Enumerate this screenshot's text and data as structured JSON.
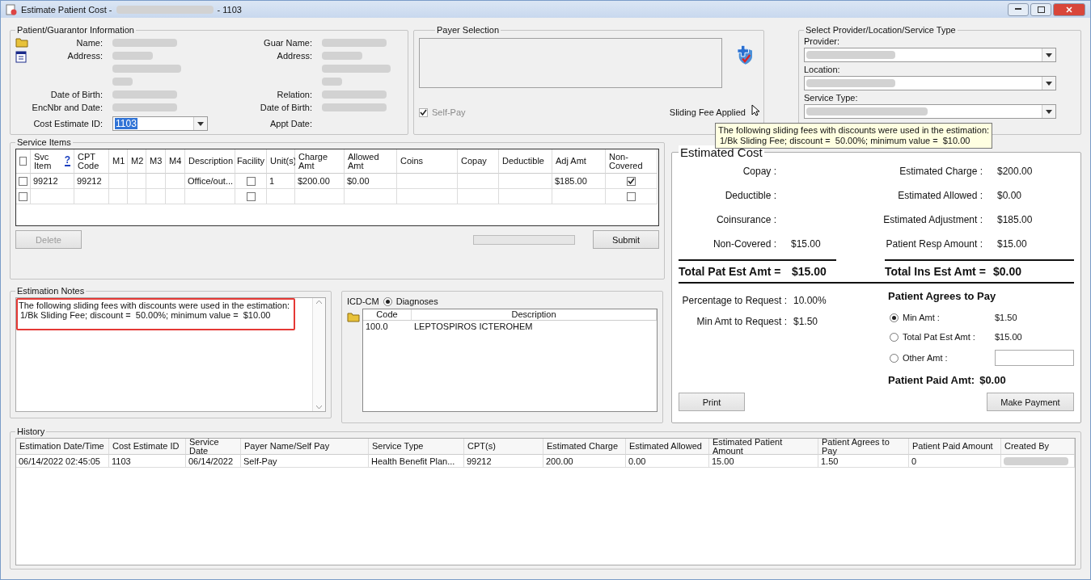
{
  "window": {
    "title": "Estimate Patient Cost -",
    "title_suffix": "- 1103"
  },
  "patient": {
    "title": "Patient/Guarantor Information",
    "left": [
      {
        "label": "Name:",
        "kind": "redacted"
      },
      {
        "label": "Address:",
        "kind": "address"
      },
      {
        "label": "Date of Birth:",
        "kind": "redacted"
      },
      {
        "label": "EncNbr and Date:",
        "kind": "redacted"
      },
      {
        "label": "Cost Estimate ID:",
        "kind": "combo",
        "value": "1103"
      }
    ],
    "right": [
      {
        "label": "Guar Name:",
        "kind": "redacted"
      },
      {
        "label": "Address:",
        "kind": "address"
      },
      {
        "label": "Relation:",
        "kind": "redacted"
      },
      {
        "label": "Date of Birth:",
        "kind": "redacted"
      },
      {
        "label": "Appt Date:",
        "kind": "blank"
      }
    ]
  },
  "payer": {
    "title": "Payer Selection",
    "self_pay": {
      "label": "Self-Pay",
      "checked": true,
      "disabled": true
    },
    "sliding_fee": "Sliding Fee Applied"
  },
  "tooltip": [
    "The following sliding fees with discounts were used in the estimation:",
    "1/Bk Sliding Fee; discount =  50.00%; minimum value =  $10.00"
  ],
  "provider": {
    "title": "Select Provider/Location/Service Type",
    "fields": [
      {
        "label": "Provider:"
      },
      {
        "label": "Location:"
      },
      {
        "label": "Service Type:"
      }
    ]
  },
  "service_items": {
    "title": "Service Items",
    "columns": [
      {
        "kind": "check",
        "checked": false
      },
      {
        "kind": "text",
        "label": "Svc Item",
        "help": "?"
      },
      {
        "kind": "text",
        "label": "CPT Code"
      },
      {
        "kind": "text",
        "label": "M1"
      },
      {
        "kind": "text",
        "label": "M2"
      },
      {
        "kind": "text",
        "label": "M3"
      },
      {
        "kind": "text",
        "label": "M4"
      },
      {
        "kind": "text",
        "label": "Description"
      },
      {
        "kind": "checkbox",
        "label": "Facility"
      },
      {
        "kind": "text",
        "label": "Unit(s)"
      },
      {
        "kind": "text",
        "label": "Charge Amt"
      },
      {
        "kind": "text",
        "label": "Allowed Amt"
      },
      {
        "kind": "text",
        "label": "Coins"
      },
      {
        "kind": "text",
        "label": "Copay"
      },
      {
        "kind": "text",
        "label": "Deductible"
      },
      {
        "kind": "text",
        "label": "Adj Amt"
      },
      {
        "kind": "checkbox",
        "label": "Non-Covered"
      }
    ],
    "rows": [
      {
        "cells": [
          false,
          "99212",
          "99212",
          null,
          null,
          null,
          null,
          "Office/out...",
          false,
          "1",
          "$200.00",
          "$0.00",
          null,
          null,
          null,
          "$185.00",
          true
        ]
      },
      {
        "cells": [
          false,
          null,
          null,
          null,
          null,
          null,
          null,
          null,
          false,
          null,
          null,
          null,
          null,
          null,
          null,
          null,
          false
        ]
      }
    ],
    "delete": {
      "label": "Delete",
      "disabled": true
    },
    "progress": {
      "level": 0
    },
    "submit": {
      "label": "Submit"
    }
  },
  "notes": {
    "title": "Estimation Notes",
    "lines": [
      "The following sliding fees with discounts were used in the estimation:",
      "1/Bk Sliding Fee; discount =  50.00%; minimum value =  $10.00"
    ],
    "highlighted": true
  },
  "icd": {
    "label": "ICD-CM",
    "radio": {
      "label": "Diagnoses",
      "selected": true
    },
    "columns": [
      "Code",
      "Description"
    ],
    "rows": [
      [
        "100.0",
        "LEPTOSPIROS ICTEROHEM"
      ]
    ]
  },
  "estimated_cost": {
    "title": "Estimated Cost",
    "rows": [
      {
        "label": "Copay :",
        "value": null,
        "label2": "Estimated Charge :",
        "value2": "$200.00"
      },
      {
        "label": "Deductible :",
        "value": null,
        "label2": "Estimated Allowed :",
        "value2": "$0.00"
      },
      {
        "label": "Coinsurance :",
        "value": null,
        "label2": "Estimated Adjustment :",
        "value2": "$185.00"
      },
      {
        "label": "Non-Covered :",
        "value": "$15.00",
        "label2": "Patient Resp Amount :",
        "value2": "$15.00"
      }
    ],
    "total_pat": {
      "label": "Total Pat Est Amt =",
      "value": "$15.00"
    },
    "total_ins": {
      "label": "Total Ins Est Amt =",
      "value": "$0.00"
    },
    "request": [
      {
        "label": "Percentage to Request :",
        "value": "10.00%"
      },
      {
        "label": "Min Amt to Request :",
        "value": "$1.50"
      }
    ],
    "agrees": {
      "title": "Patient Agrees to Pay",
      "options": [
        {
          "kind": "amount",
          "label": "Min Amt :",
          "value": "$1.50",
          "selected": true
        },
        {
          "kind": "amount",
          "label": "Total Pat Est Amt :",
          "value": "$15.00",
          "selected": false
        },
        {
          "kind": "input",
          "label": "Other Amt :",
          "selected": false
        }
      ]
    },
    "paid": {
      "label": "Patient Paid Amt:",
      "value": "$0.00"
    },
    "print": "Print",
    "make_payment": "Make Payment"
  },
  "history": {
    "title": "History",
    "columns": [
      "Estimation Date/Time",
      "Cost Estimate ID",
      "Service Date",
      "Payer Name/Self Pay",
      "Service Type",
      "CPT(s)",
      "Estimated Charge",
      "Estimated Allowed",
      "Estimated Patient Amount",
      "Patient Agrees to Pay",
      "Patient Paid Amount",
      "Created By"
    ],
    "rows": [
      [
        "06/14/2022 02:45:05",
        "1103",
        "06/14/2022",
        "Self-Pay",
        "Health Benefit Plan...",
        "99212",
        "200.00",
        "0.00",
        "15.00",
        "1.50",
        "0",
        null
      ]
    ]
  }
}
